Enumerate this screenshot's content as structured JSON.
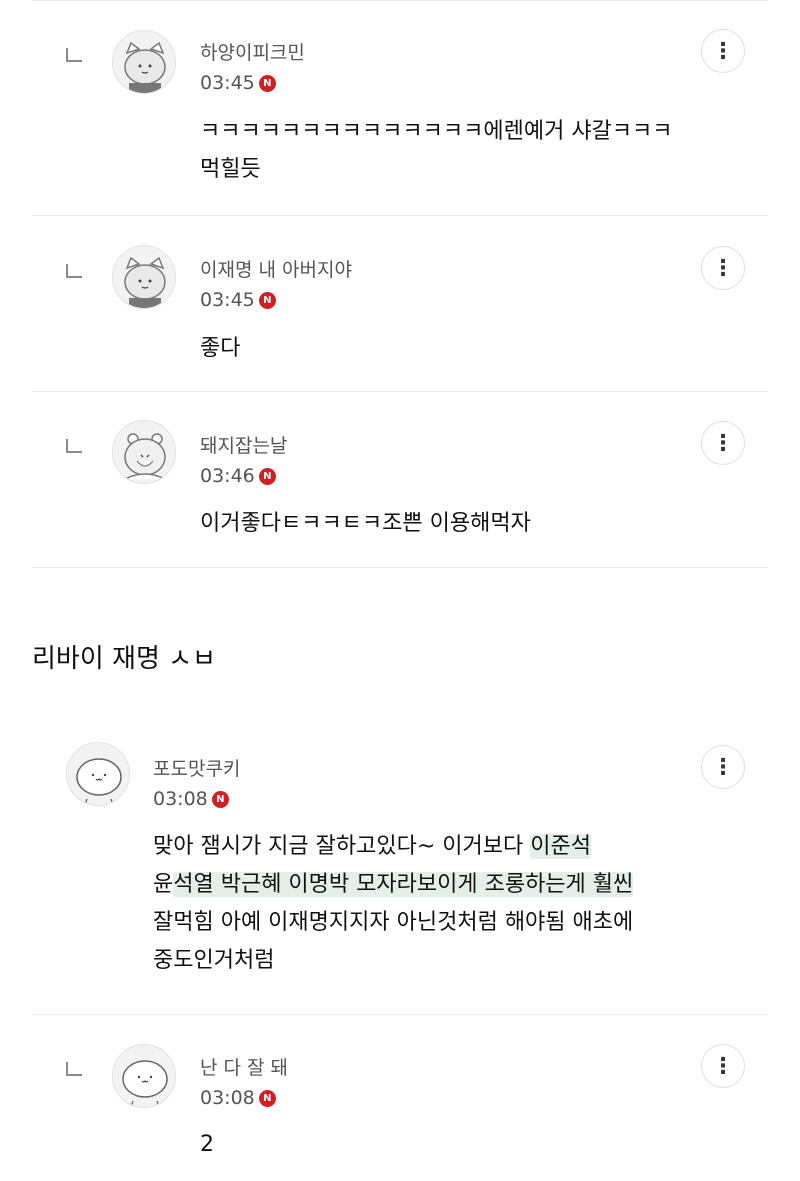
{
  "comments": [
    {
      "nick": "하양이피크민",
      "time": "03:45",
      "badge": "N",
      "line1": "ㅋㅋㅋㅋㅋㅋㅋㅋㅋㅋㅋㅋㅋㅋ에렌예거 샤갈ㅋㅋㅋ",
      "line2": "먹힐듯"
    },
    {
      "nick": "이재명 내 아버지야",
      "time": "03:45",
      "badge": "N",
      "line1": "좋다"
    },
    {
      "nick": "돼지잡는날",
      "time": "03:46",
      "badge": "N",
      "line1": "이거좋다ㅌㅋㅋㅌㅋ조쁜 이용해먹자"
    }
  ],
  "post": {
    "title": "리바이 재명 ㅅㅂ"
  },
  "main_comment": {
    "nick": "포도맛쿠키",
    "time": "03:08",
    "badge": "N",
    "l1a": "맞아 잼시가 지금 잘하고있다~ 이거보다 ",
    "l1b": "이준석",
    "l2a": "윤",
    "l2b": "석열 박근혜 이명박 모자라보이게 조롱하는게 훨씬",
    "l3": "잘먹힘 아예 이재명지지자 아닌것처럼 해야됨 애초에",
    "l4": "중도인거처럼"
  },
  "reply": {
    "nick": "난 다 잘 돼",
    "time": "03:08",
    "badge": "N",
    "text": "2"
  },
  "icons": {
    "more": "more-vertical-icon",
    "reply": "reply-arrow-icon",
    "new_badge": "new-badge-icon"
  }
}
